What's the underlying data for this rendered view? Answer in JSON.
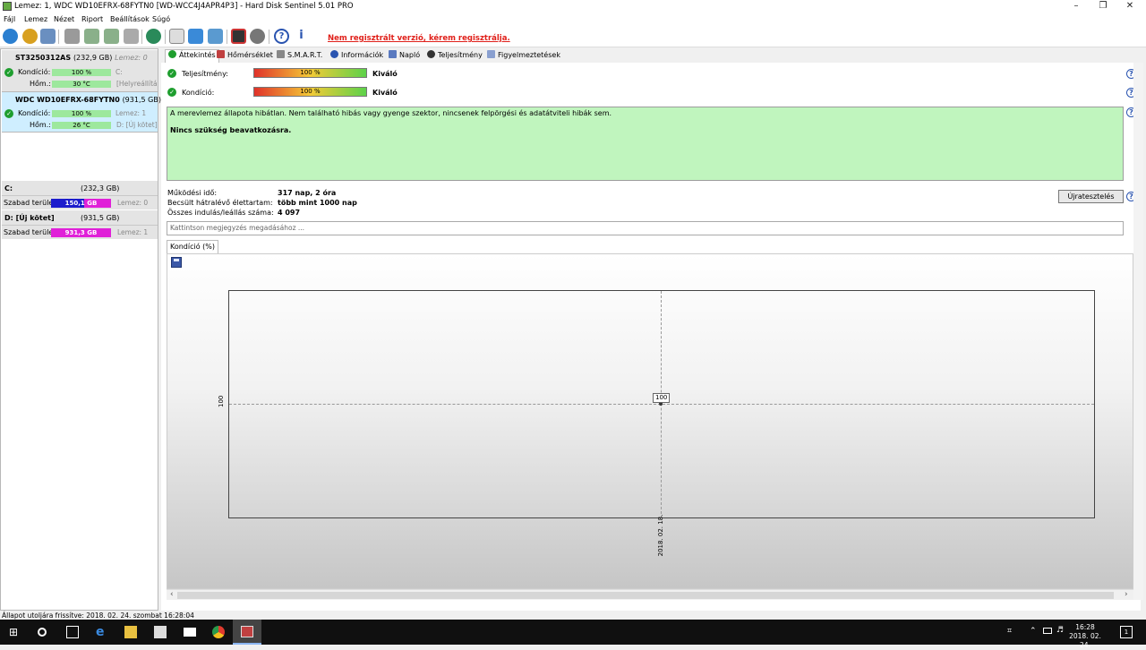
{
  "window": {
    "title": "Lemez: 1, WDC WD10EFRX-68FYTN0 [WD-WCC4J4APR4P3]  -  Hard Disk Sentinel 5.01 PRO"
  },
  "menu": [
    "Fájl",
    "Lemez",
    "Nézet",
    "Riport",
    "Beállítások",
    "Súgó"
  ],
  "registration": "Nem regisztrált verzió, kérem regisztrálja.",
  "disks": [
    {
      "name": "ST3250312AS",
      "size": "(232,9 GB)",
      "disk_label": "Lemez: 0",
      "condition_label": "Kondíció:",
      "condition": "100 %",
      "temp_label": "Hőm.:",
      "temp": "30 °C",
      "side1": "C:",
      "side2": "[Helyreállítás"
    },
    {
      "name": "WDC WD10EFRX-68FYTN0",
      "size": "(931,5 GB)",
      "condition_label": "Kondíció:",
      "condition": "100 %",
      "temp_label": "Hőm.:",
      "temp": "26 °C",
      "side1": "Lemez: 1",
      "side2": "D: [Új kötet]"
    }
  ],
  "volumes": [
    {
      "name": "C:",
      "size": "(232,3 GB)",
      "free_label": "Szabad terület",
      "free": "150,1 GB",
      "disk": "Lemez: 0",
      "color": "#2a2acc"
    },
    {
      "name": "D: [Új kötet]",
      "size": "(931,5 GB)",
      "free_label": "Szabad terület",
      "free": "931,3 GB",
      "disk": "Lemez: 1",
      "color": "#e020d8"
    }
  ],
  "tabs": [
    "Áttekintés",
    "Hőmérséklet",
    "S.M.A.R.T.",
    "Információk",
    "Napló",
    "Teljesítmény",
    "Figyelmeztetések"
  ],
  "overview": {
    "perf_label": "Teljesítmény:",
    "perf_value": "100 %",
    "perf_status": "Kiváló",
    "cond_label": "Kondíció:",
    "cond_value": "100 %",
    "cond_status": "Kiváló",
    "status_line1": "A merevlemez állapota hibátlan. Nem található hibás vagy gyenge szektor, nincsenek felpörgési és adatátviteli hibák sem.",
    "status_line2": "Nincs szükség beavatkozásra.",
    "uptime_label": "Működési idő:",
    "uptime": "317 nap, 2 óra",
    "life_label": "Becsült hátralévő élettartam:",
    "life": "több mint 1000 nap",
    "starts_label": "Összes indulás/leállás száma:",
    "starts": "4 097",
    "retest_button": "Újratesztelés",
    "note_placeholder": "Kattintson megjegyzés megadásához ..."
  },
  "graph_tab": "Kondíció  (%)",
  "chart_data": {
    "type": "line",
    "x": [
      "2018. 02. 18."
    ],
    "series": [
      {
        "values": [
          100
        ]
      }
    ],
    "y_tick_labels": [
      "100"
    ],
    "data_labels": [
      "100"
    ],
    "grid": true
  },
  "status_bar": "Állapot utoljára frissítve: 2018. 02. 24. szombat 16:28:04",
  "taskbar": {
    "time": "16:28",
    "date": "2018. 02. 24.",
    "notif_count": "1"
  }
}
